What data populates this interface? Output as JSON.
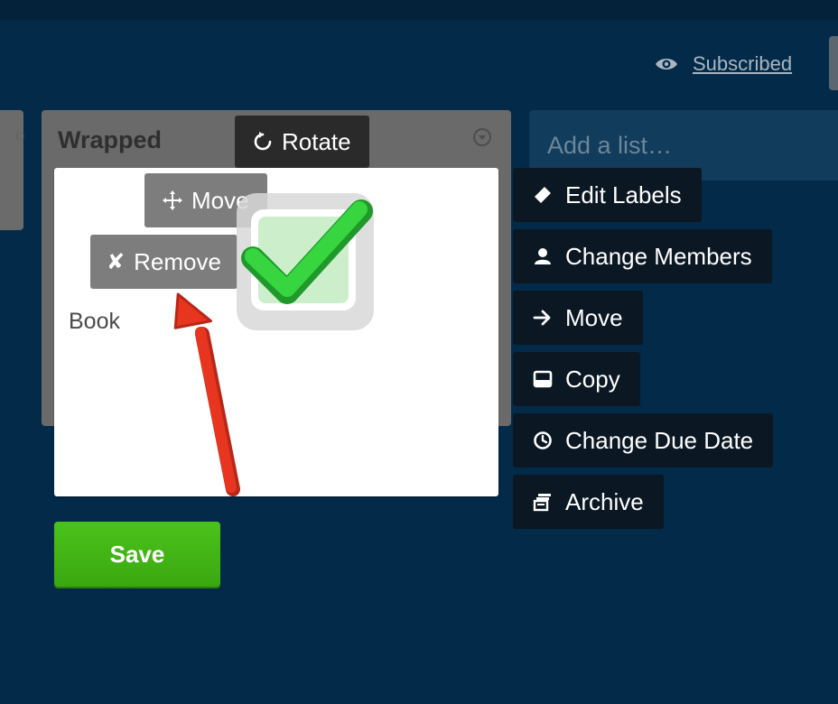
{
  "header": {
    "subscribed_label": "Subscribed"
  },
  "list": {
    "title": "Wrapped"
  },
  "add_list": {
    "placeholder": "Add a list…"
  },
  "card": {
    "text": "Book",
    "overlay": {
      "rotate_label": "Rotate",
      "move_label": "Move",
      "remove_label": "Remove"
    }
  },
  "card_actions": [
    {
      "label": "Edit Labels",
      "icon": "tag-icon"
    },
    {
      "label": "Change Members",
      "icon": "person-icon"
    },
    {
      "label": "Move",
      "icon": "arrow-right-icon"
    },
    {
      "label": "Copy",
      "icon": "copy-icon"
    },
    {
      "label": "Change Due Date",
      "icon": "clock-icon"
    },
    {
      "label": "Archive",
      "icon": "archive-icon"
    }
  ],
  "save_label": "Save",
  "colors": {
    "board_background": "#032a48",
    "save_green": "#3fb515",
    "action_background": "#0b1722",
    "annotation_arrow": "#e8351f",
    "checkmark": "#2ecc40"
  }
}
